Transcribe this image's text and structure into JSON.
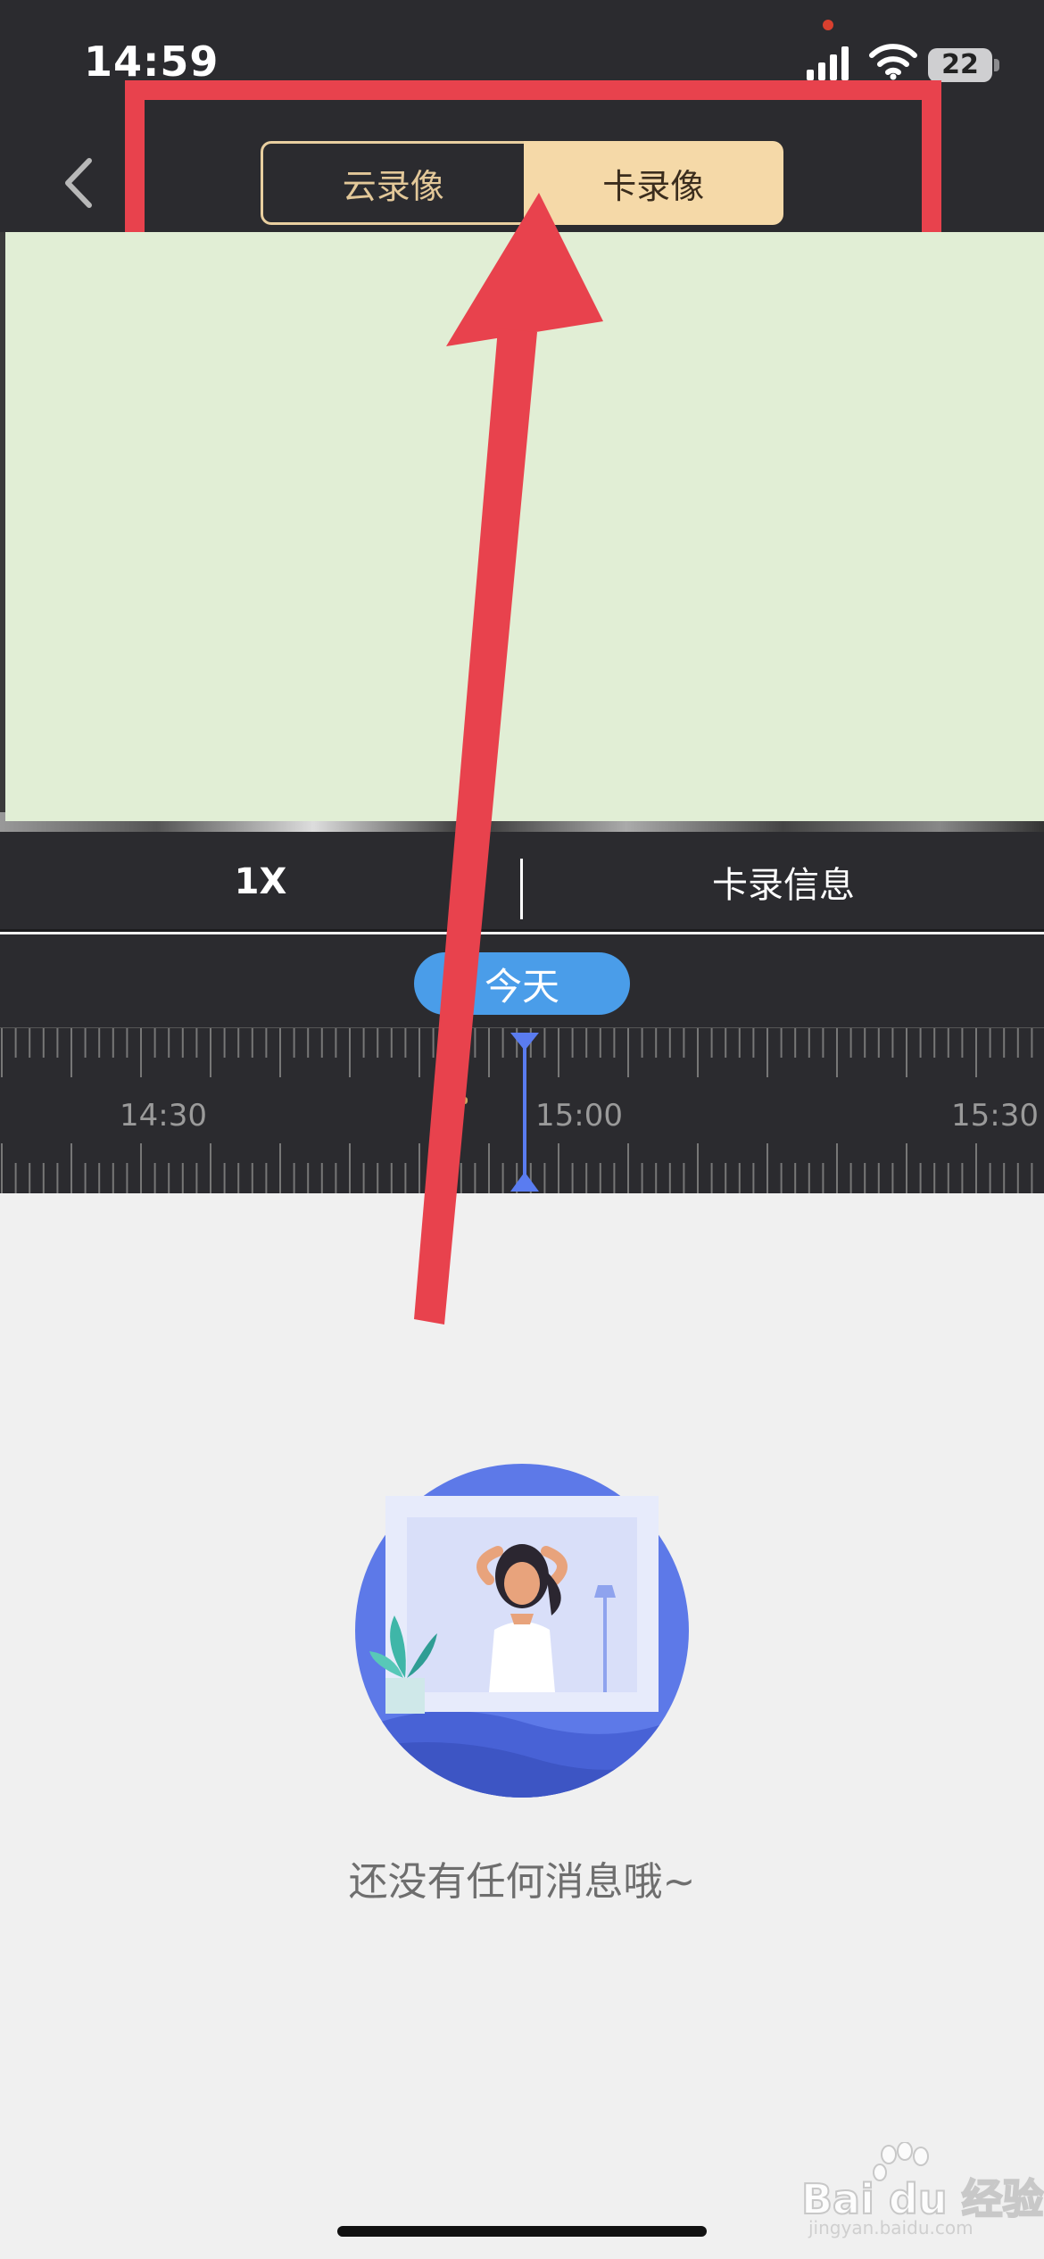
{
  "status_bar": {
    "time": "14:59",
    "battery": "22"
  },
  "header": {
    "tabs": [
      {
        "label": "云录像",
        "selected": false
      },
      {
        "label": "卡录像",
        "selected": true
      }
    ]
  },
  "controls": {
    "speed": "1X",
    "card_info": "卡录信息"
  },
  "timeline": {
    "date_chip": "今天",
    "labels": [
      "14:30",
      "15:00",
      "15:30"
    ]
  },
  "empty_state": {
    "message": "还没有任何消息哦~"
  },
  "watermark": {
    "brand": "Bai du 经验",
    "url": "jingyan.baidu.com"
  },
  "colors": {
    "accent_gold": "#f5d9a8",
    "date_chip_blue": "#4a9de9",
    "annotation_red": "#e8424d",
    "playhead_blue": "#5a7cf0"
  }
}
